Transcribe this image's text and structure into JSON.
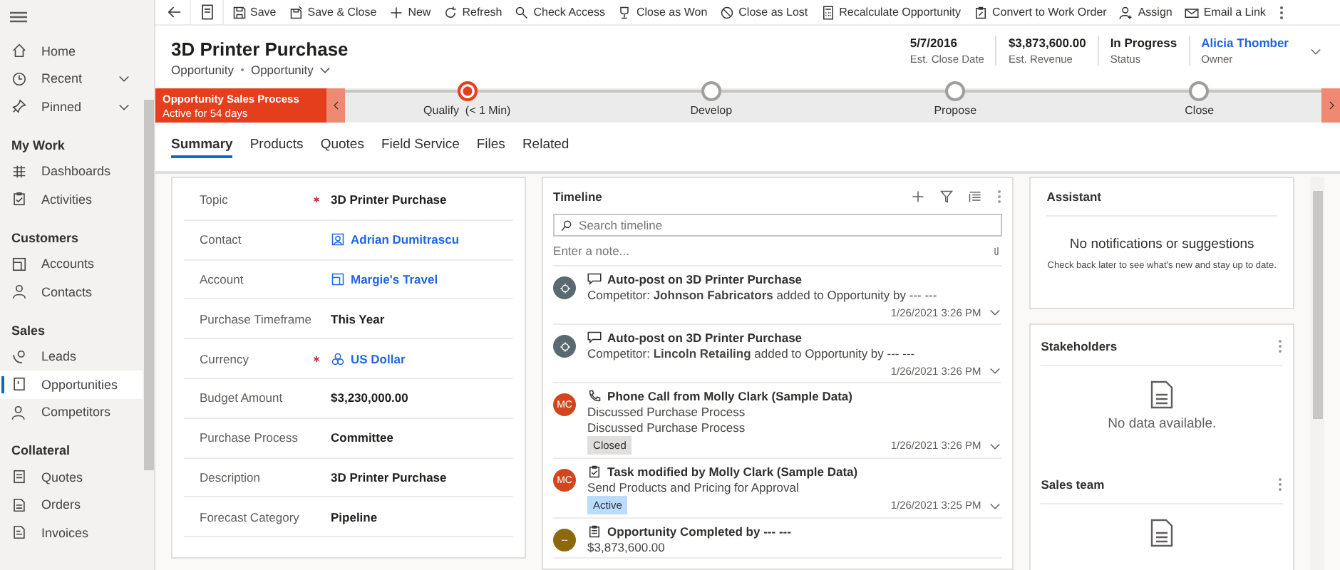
{
  "sidebar": {
    "sections": [
      {
        "items": [
          {
            "label": "Home",
            "selected": false,
            "expandable": false
          },
          {
            "label": "Recent",
            "selected": false,
            "expandable": true
          },
          {
            "label": "Pinned",
            "selected": false,
            "expandable": true
          }
        ]
      },
      {
        "title": "My Work",
        "items": [
          {
            "label": "Dashboards",
            "selected": false,
            "expandable": false
          },
          {
            "label": "Activities",
            "selected": false,
            "expandable": false
          }
        ]
      },
      {
        "title": "Customers",
        "items": [
          {
            "label": "Accounts",
            "selected": false,
            "expandable": false
          },
          {
            "label": "Contacts",
            "selected": false,
            "expandable": false
          }
        ]
      },
      {
        "title": "Sales",
        "items": [
          {
            "label": "Leads",
            "selected": false,
            "expandable": false
          },
          {
            "label": "Opportunities",
            "selected": true,
            "expandable": false
          },
          {
            "label": "Competitors",
            "selected": false,
            "expandable": false
          }
        ]
      },
      {
        "title": "Collateral",
        "items": [
          {
            "label": "Quotes",
            "selected": false,
            "expandable": false
          },
          {
            "label": "Orders",
            "selected": false,
            "expandable": false
          },
          {
            "label": "Invoices",
            "selected": false,
            "expandable": false
          }
        ]
      }
    ]
  },
  "toolbar": {
    "commands": [
      "Save",
      "Save & Close",
      "New",
      "Refresh",
      "Check Access",
      "Close as Won",
      "Close as Lost",
      "Recalculate Opportunity",
      "Convert to Work Order",
      "Assign",
      "Email a Link"
    ]
  },
  "header": {
    "title": "3D Printer Purchase",
    "entity": "Opportunity",
    "form": "Opportunity",
    "fields": [
      {
        "value": "5/7/2016",
        "label": "Est. Close Date",
        "kind": "text"
      },
      {
        "value": "$3,873,600.00",
        "label": "Est. Revenue",
        "kind": "text"
      },
      {
        "value": "In Progress",
        "label": "Status",
        "kind": "text"
      },
      {
        "value": "Alicia Thomber",
        "label": "Owner",
        "kind": "link"
      }
    ]
  },
  "process": {
    "name": "Opportunity Sales Process",
    "active_for": "Active for 54 days",
    "stages": [
      {
        "label": "Qualify",
        "duration": "(< 1 Min)",
        "selected": true
      },
      {
        "label": "Develop",
        "selected": false
      },
      {
        "label": "Propose",
        "selected": false
      },
      {
        "label": "Close",
        "selected": false
      }
    ]
  },
  "tabs": [
    {
      "label": "Summary",
      "selected": true
    },
    {
      "label": "Products",
      "selected": false
    },
    {
      "label": "Quotes",
      "selected": false
    },
    {
      "label": "Field Service",
      "selected": false
    },
    {
      "label": "Files",
      "selected": false
    },
    {
      "label": "Related",
      "selected": false
    }
  ],
  "form": {
    "fields": [
      {
        "label": "Topic",
        "required": true,
        "value": "3D Printer Purchase",
        "kind": "text"
      },
      {
        "label": "Contact",
        "required": false,
        "value": "Adrian Dumitrascu",
        "kind": "contact"
      },
      {
        "label": "Account",
        "required": false,
        "value": "Margie's Travel",
        "kind": "account"
      },
      {
        "label": "Purchase Timeframe",
        "required": false,
        "value": "This Year",
        "kind": "text"
      },
      {
        "label": "Currency",
        "required": true,
        "value": "US Dollar",
        "kind": "currency"
      },
      {
        "label": "Budget Amount",
        "required": false,
        "value": "$3,230,000.00",
        "kind": "text"
      },
      {
        "label": "Purchase Process",
        "required": false,
        "value": "Committee",
        "kind": "text"
      },
      {
        "label": "Description",
        "required": false,
        "value": "3D Printer Purchase",
        "kind": "text"
      },
      {
        "label": "Forecast Category",
        "required": false,
        "value": "Pipeline",
        "kind": "text"
      }
    ]
  },
  "timeline": {
    "title": "Timeline",
    "search": {
      "placeholder": "Search timeline"
    },
    "note": {
      "placeholder": "Enter a note..."
    },
    "entries": [
      {
        "kind": "post",
        "avatar": {
          "color": "#5b6a71"
        },
        "title": "Auto-post on 3D Printer Purchase",
        "lines": [
          "Competitor: **Johnson Fabricators** added to Opportunity by --- ---"
        ],
        "time": "1/26/2021 3:26 PM"
      },
      {
        "kind": "post",
        "avatar": {
          "color": "#5b6a71"
        },
        "title": "Auto-post on 3D Printer Purchase",
        "lines": [
          "Competitor: **Lincoln Retailing** added to Opportunity by --- ---"
        ],
        "time": "1/26/2021 3:26 PM"
      },
      {
        "kind": "phone",
        "avatar": {
          "initials": "MC",
          "color": "#d2461e"
        },
        "title": "Phone Call from Molly Clark (Sample Data)",
        "lines": [
          "Discussed Purchase Process",
          "Discussed Purchase Process"
        ],
        "badge": {
          "text": "Closed",
          "kind": "closed"
        },
        "time": "1/26/2021 3:26 PM"
      },
      {
        "kind": "task",
        "avatar": {
          "initials": "MC",
          "color": "#d2461e"
        },
        "title": "Task modified by Molly Clark (Sample Data)",
        "lines": [
          "Send Products and Pricing for Approval"
        ],
        "badge": {
          "text": "Active",
          "kind": "active"
        },
        "time": "1/26/2021 3:25 PM"
      },
      {
        "kind": "opportunity",
        "avatar": {
          "initials": "--",
          "color": "#8c6a0c"
        },
        "title": "Opportunity Completed by --- ---",
        "lines": [
          "$3,873,600.00"
        ]
      }
    ]
  },
  "assistant": {
    "title": "Assistant",
    "heading": "No notifications or suggestions",
    "message": "Check back later to see what's new and stay up to date."
  },
  "subgrids": [
    {
      "title": "Stakeholders",
      "empty": "No data available."
    },
    {
      "title": "Sales team"
    }
  ]
}
